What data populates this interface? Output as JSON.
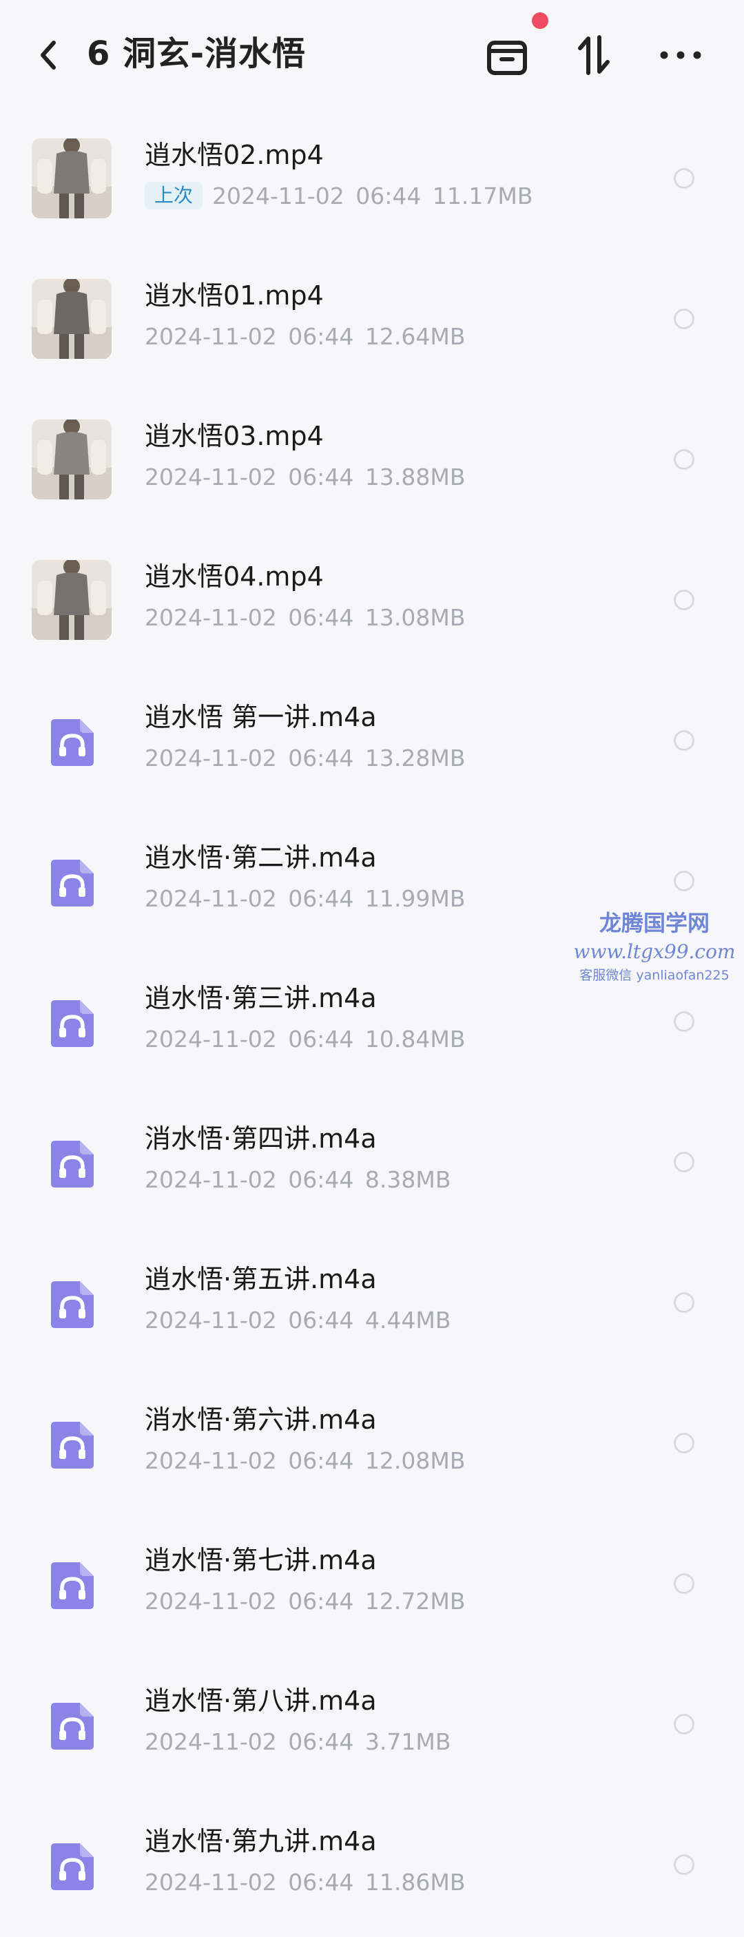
{
  "header": {
    "title": "6 洞玄-消水悟"
  },
  "files": [
    {
      "name": "逍水悟02.mp4",
      "date": "2024-11-02",
      "time": "06:44",
      "size": "11.17MB",
      "type": "video",
      "badge": "上次"
    },
    {
      "name": "逍水悟01.mp4",
      "date": "2024-11-02",
      "time": "06:44",
      "size": "12.64MB",
      "type": "video"
    },
    {
      "name": "逍水悟03.mp4",
      "date": "2024-11-02",
      "time": "06:44",
      "size": "13.88MB",
      "type": "video"
    },
    {
      "name": "逍水悟04.mp4",
      "date": "2024-11-02",
      "time": "06:44",
      "size": "13.08MB",
      "type": "video"
    },
    {
      "name": "逍水悟 第一讲.m4a",
      "date": "2024-11-02",
      "time": "06:44",
      "size": "13.28MB",
      "type": "audio"
    },
    {
      "name": "逍水悟·第二讲.m4a",
      "date": "2024-11-02",
      "time": "06:44",
      "size": "11.99MB",
      "type": "audio"
    },
    {
      "name": "逍水悟·第三讲.m4a",
      "date": "2024-11-02",
      "time": "06:44",
      "size": "10.84MB",
      "type": "audio"
    },
    {
      "name": "消水悟·第四讲.m4a",
      "date": "2024-11-02",
      "time": "06:44",
      "size": "8.38MB",
      "type": "audio"
    },
    {
      "name": "逍水悟·第五讲.m4a",
      "date": "2024-11-02",
      "time": "06:44",
      "size": "4.44MB",
      "type": "audio"
    },
    {
      "name": "消水悟·第六讲.m4a",
      "date": "2024-11-02",
      "time": "06:44",
      "size": "12.08MB",
      "type": "audio"
    },
    {
      "name": "逍水悟·第七讲.m4a",
      "date": "2024-11-02",
      "time": "06:44",
      "size": "12.72MB",
      "type": "audio"
    },
    {
      "name": "逍水悟·第八讲.m4a",
      "date": "2024-11-02",
      "time": "06:44",
      "size": "3.71MB",
      "type": "audio"
    },
    {
      "name": "逍水悟·第九讲.m4a",
      "date": "2024-11-02",
      "time": "06:44",
      "size": "11.86MB",
      "type": "audio"
    }
  ],
  "watermark": {
    "line1": "龙腾国学网",
    "line2": "www.ltgx99.com",
    "line3": "客服微信 yanliaofan225"
  },
  "colors": {
    "accent": "#8b83e6",
    "badge_bg": "#e4f2f8",
    "badge_text": "#2b8bc6",
    "notify_dot": "#ee4a63",
    "meta_text": "#a9abb2"
  }
}
